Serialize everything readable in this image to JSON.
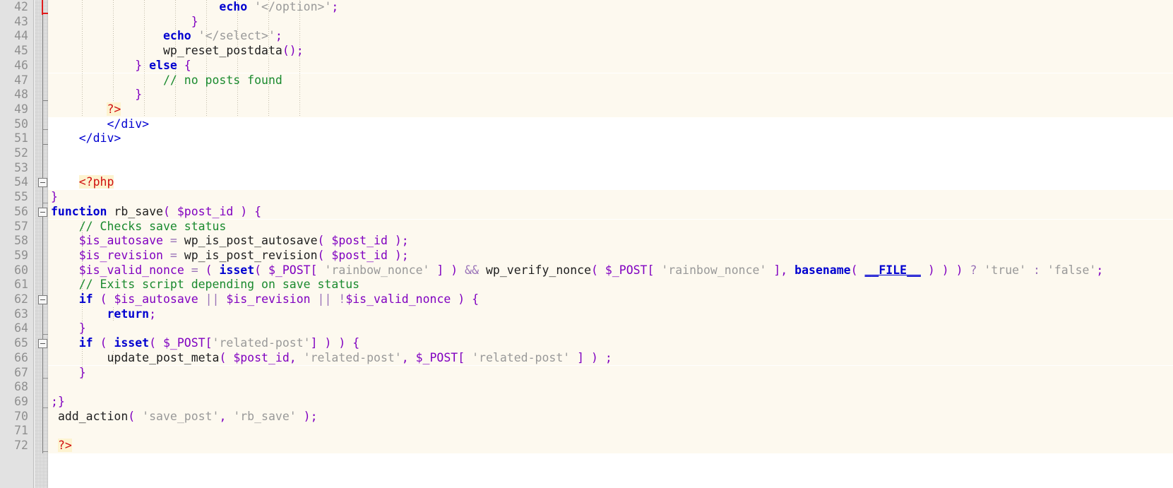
{
  "editor": {
    "name": "php-source-editor",
    "language": "PHP",
    "line_height": 20.7,
    "first_visible_line": 42,
    "last_visible_line": 72,
    "char_width": 11.0,
    "colors": {
      "php_background": "#fdf9ef",
      "html_background": "#ffffff",
      "gutter_background": "#e2e2e2",
      "gutter_text": "#8f8f8f",
      "keyword": "#0000d0",
      "variable": "#8000c0",
      "string": "#999999",
      "comment": "#1a8a2e",
      "punctuation": "#8000c0",
      "operator": "#9a73b8",
      "php_tag": "#d01010",
      "php_tag_highlight": "#fdf3d0",
      "html_tag": "#0000d0",
      "fold_marker_red": "#e01b1b"
    }
  },
  "gutter": {
    "line_numbers": [
      42,
      43,
      44,
      45,
      46,
      47,
      48,
      49,
      50,
      51,
      52,
      53,
      54,
      55,
      56,
      57,
      58,
      59,
      60,
      61,
      62,
      63,
      64,
      65,
      66,
      67,
      68,
      69,
      70,
      71,
      72
    ]
  },
  "fold_markers": [
    {
      "line": 54,
      "type": "collapse-box"
    },
    {
      "line": 56,
      "type": "collapse-box"
    },
    {
      "line": 62,
      "type": "collapse-box"
    },
    {
      "line": 65,
      "type": "collapse-box"
    }
  ],
  "lines": [
    {
      "n": 42,
      "bg": "php",
      "indent_guides": 8,
      "tokens": [
        {
          "t": "                        ",
          "c": "plain"
        },
        {
          "t": "echo",
          "c": "kw"
        },
        {
          "t": " ",
          "c": "plain"
        },
        {
          "t": "'</option>'",
          "c": "str"
        },
        {
          "t": ";",
          "c": "punc"
        }
      ]
    },
    {
      "n": 43,
      "bg": "php",
      "indent_guides": 8,
      "tokens": [
        {
          "t": "                    ",
          "c": "plain"
        },
        {
          "t": "}",
          "c": "brace"
        }
      ]
    },
    {
      "n": 44,
      "bg": "php",
      "indent_guides": 8,
      "tokens": [
        {
          "t": "                ",
          "c": "plain"
        },
        {
          "t": "echo",
          "c": "kw"
        },
        {
          "t": " ",
          "c": "plain"
        },
        {
          "t": "'</select>'",
          "c": "str"
        },
        {
          "t": ";",
          "c": "punc"
        }
      ]
    },
    {
      "n": 45,
      "bg": "php",
      "indent_guides": 8,
      "tokens": [
        {
          "t": "                ",
          "c": "plain"
        },
        {
          "t": "wp_reset_postdata",
          "c": "fn"
        },
        {
          "t": "()",
          "c": "punc"
        },
        {
          "t": ";",
          "c": "punc"
        }
      ]
    },
    {
      "n": 46,
      "bg": "php",
      "indent_guides": 8,
      "tokens": [
        {
          "t": "            ",
          "c": "plain"
        },
        {
          "t": "}",
          "c": "brace"
        },
        {
          "t": " ",
          "c": "plain"
        },
        {
          "t": "else",
          "c": "kw"
        },
        {
          "t": " ",
          "c": "plain"
        },
        {
          "t": "{",
          "c": "brace"
        }
      ]
    },
    {
      "n": 47,
      "bg": "php",
      "indent_guides": 8,
      "tokens": [
        {
          "t": "                ",
          "c": "plain"
        },
        {
          "t": "// no posts found",
          "c": "cmt"
        }
      ]
    },
    {
      "n": 48,
      "bg": "php",
      "indent_guides": 8,
      "tokens": [
        {
          "t": "            ",
          "c": "plain"
        },
        {
          "t": "}",
          "c": "brace"
        }
      ]
    },
    {
      "n": 49,
      "bg": "php",
      "indent_guides": 8,
      "tokens": [
        {
          "t": "        ",
          "c": "plain"
        },
        {
          "t": "?>",
          "c": "php"
        }
      ]
    },
    {
      "n": 50,
      "bg": "html",
      "indent_guides": 0,
      "tokens": [
        {
          "t": "        ",
          "c": "plain"
        },
        {
          "t": "</div>",
          "c": "tag"
        }
      ]
    },
    {
      "n": 51,
      "bg": "html",
      "indent_guides": 0,
      "tokens": [
        {
          "t": "    ",
          "c": "plain"
        },
        {
          "t": "</div>",
          "c": "tag"
        }
      ]
    },
    {
      "n": 52,
      "bg": "html",
      "indent_guides": 0,
      "tokens": []
    },
    {
      "n": 53,
      "bg": "html",
      "indent_guides": 0,
      "tokens": []
    },
    {
      "n": 54,
      "bg": "html",
      "indent_guides": 0,
      "tokens": [
        {
          "t": "    ",
          "c": "plain"
        },
        {
          "t": "<?php",
          "c": "php"
        }
      ]
    },
    {
      "n": 55,
      "bg": "php",
      "indent_guides": 0,
      "tokens": [
        {
          "t": "}",
          "c": "brace"
        }
      ]
    },
    {
      "n": 56,
      "bg": "php",
      "indent_guides": 0,
      "tokens": [
        {
          "t": "function",
          "c": "kw"
        },
        {
          "t": " ",
          "c": "plain"
        },
        {
          "t": "rb_save",
          "c": "fn"
        },
        {
          "t": "( ",
          "c": "punc"
        },
        {
          "t": "$post_id",
          "c": "var"
        },
        {
          "t": " ) ",
          "c": "punc"
        },
        {
          "t": "{",
          "c": "brace"
        }
      ]
    },
    {
      "n": 57,
      "bg": "php",
      "indent_guides": 1,
      "tokens": [
        {
          "t": "    ",
          "c": "plain"
        },
        {
          "t": "// Checks save status",
          "c": "cmt"
        }
      ]
    },
    {
      "n": 58,
      "bg": "php",
      "indent_guides": 1,
      "tokens": [
        {
          "t": "    ",
          "c": "plain"
        },
        {
          "t": "$is_autosave",
          "c": "var"
        },
        {
          "t": " = ",
          "c": "op"
        },
        {
          "t": "wp_is_post_autosave",
          "c": "fn"
        },
        {
          "t": "( ",
          "c": "punc"
        },
        {
          "t": "$post_id",
          "c": "var"
        },
        {
          "t": " )",
          "c": "punc"
        },
        {
          "t": ";",
          "c": "punc"
        }
      ]
    },
    {
      "n": 59,
      "bg": "php",
      "indent_guides": 1,
      "tokens": [
        {
          "t": "    ",
          "c": "plain"
        },
        {
          "t": "$is_revision",
          "c": "var"
        },
        {
          "t": " = ",
          "c": "op"
        },
        {
          "t": "wp_is_post_revision",
          "c": "fn"
        },
        {
          "t": "( ",
          "c": "punc"
        },
        {
          "t": "$post_id",
          "c": "var"
        },
        {
          "t": " )",
          "c": "punc"
        },
        {
          "t": ";",
          "c": "punc"
        }
      ]
    },
    {
      "n": 60,
      "bg": "php",
      "indent_guides": 1,
      "tokens": [
        {
          "t": "    ",
          "c": "plain"
        },
        {
          "t": "$is_valid_nonce",
          "c": "var"
        },
        {
          "t": " = ",
          "c": "op"
        },
        {
          "t": "( ",
          "c": "punc"
        },
        {
          "t": "isset",
          "c": "kw"
        },
        {
          "t": "( ",
          "c": "punc"
        },
        {
          "t": "$_POST",
          "c": "var"
        },
        {
          "t": "[ ",
          "c": "punc"
        },
        {
          "t": "'rainbow_nonce'",
          "c": "str"
        },
        {
          "t": " ] )",
          "c": "punc"
        },
        {
          "t": " && ",
          "c": "op"
        },
        {
          "t": "wp_verify_nonce",
          "c": "fn"
        },
        {
          "t": "( ",
          "c": "punc"
        },
        {
          "t": "$_POST",
          "c": "var"
        },
        {
          "t": "[ ",
          "c": "punc"
        },
        {
          "t": "'rainbow_nonce'",
          "c": "str"
        },
        {
          "t": " ]",
          "c": "punc"
        },
        {
          "t": ", ",
          "c": "punc"
        },
        {
          "t": "basename",
          "c": "kw"
        },
        {
          "t": "( ",
          "c": "punc"
        },
        {
          "t": "__FILE__",
          "c": "magic"
        },
        {
          "t": " ) ) )",
          "c": "punc"
        },
        {
          "t": " ? ",
          "c": "op"
        },
        {
          "t": "'true'",
          "c": "str"
        },
        {
          "t": " : ",
          "c": "op"
        },
        {
          "t": "'false'",
          "c": "str"
        },
        {
          "t": ";",
          "c": "punc"
        }
      ]
    },
    {
      "n": 61,
      "bg": "php",
      "indent_guides": 1,
      "tokens": [
        {
          "t": "    ",
          "c": "plain"
        },
        {
          "t": "// Exits script depending on save status",
          "c": "cmt"
        }
      ]
    },
    {
      "n": 62,
      "bg": "php",
      "indent_guides": 1,
      "tokens": [
        {
          "t": "    ",
          "c": "plain"
        },
        {
          "t": "if",
          "c": "kw"
        },
        {
          "t": " ",
          "c": "plain"
        },
        {
          "t": "( ",
          "c": "punc"
        },
        {
          "t": "$is_autosave",
          "c": "var"
        },
        {
          "t": " || ",
          "c": "op"
        },
        {
          "t": "$is_revision",
          "c": "var"
        },
        {
          "t": " || ",
          "c": "op"
        },
        {
          "t": "!",
          "c": "op"
        },
        {
          "t": "$is_valid_nonce",
          "c": "var"
        },
        {
          "t": " ) ",
          "c": "punc"
        },
        {
          "t": "{",
          "c": "brace"
        }
      ]
    },
    {
      "n": 63,
      "bg": "php",
      "indent_guides": 2,
      "tokens": [
        {
          "t": "        ",
          "c": "plain"
        },
        {
          "t": "return",
          "c": "kw"
        },
        {
          "t": ";",
          "c": "punc"
        }
      ]
    },
    {
      "n": 64,
      "bg": "php",
      "indent_guides": 1,
      "tokens": [
        {
          "t": "    ",
          "c": "plain"
        },
        {
          "t": "}",
          "c": "brace"
        }
      ]
    },
    {
      "n": 65,
      "bg": "php",
      "indent_guides": 1,
      "tokens": [
        {
          "t": "    ",
          "c": "plain"
        },
        {
          "t": "if",
          "c": "kw"
        },
        {
          "t": " ",
          "c": "plain"
        },
        {
          "t": "( ",
          "c": "punc"
        },
        {
          "t": "isset",
          "c": "kw"
        },
        {
          "t": "( ",
          "c": "punc"
        },
        {
          "t": "$_POST",
          "c": "var"
        },
        {
          "t": "[",
          "c": "punc"
        },
        {
          "t": "'related-post'",
          "c": "str"
        },
        {
          "t": "]",
          "c": "punc"
        },
        {
          "t": " ) ) ",
          "c": "punc"
        },
        {
          "t": "{",
          "c": "brace"
        }
      ]
    },
    {
      "n": 66,
      "bg": "php",
      "indent_guides": 2,
      "tokens": [
        {
          "t": "        ",
          "c": "plain"
        },
        {
          "t": "update_post_meta",
          "c": "fn"
        },
        {
          "t": "( ",
          "c": "punc"
        },
        {
          "t": "$post_id",
          "c": "var"
        },
        {
          "t": ", ",
          "c": "punc"
        },
        {
          "t": "'related-post'",
          "c": "str"
        },
        {
          "t": ", ",
          "c": "punc"
        },
        {
          "t": "$_POST",
          "c": "var"
        },
        {
          "t": "[ ",
          "c": "punc"
        },
        {
          "t": "'related-post'",
          "c": "str"
        },
        {
          "t": " ] )",
          "c": "punc"
        },
        {
          "t": " ;",
          "c": "punc"
        }
      ]
    },
    {
      "n": 67,
      "bg": "php",
      "indent_guides": 1,
      "tokens": [
        {
          "t": "    ",
          "c": "plain"
        },
        {
          "t": "}",
          "c": "brace"
        }
      ]
    },
    {
      "n": 68,
      "bg": "php",
      "indent_guides": 0,
      "tokens": []
    },
    {
      "n": 69,
      "bg": "php",
      "indent_guides": 0,
      "tokens": [
        {
          "t": ";",
          "c": "punc"
        },
        {
          "t": "}",
          "c": "brace"
        }
      ]
    },
    {
      "n": 70,
      "bg": "php",
      "indent_guides": 0,
      "tokens": [
        {
          "t": " ",
          "c": "plain"
        },
        {
          "t": "add_action",
          "c": "fn"
        },
        {
          "t": "( ",
          "c": "punc"
        },
        {
          "t": "'save_post'",
          "c": "str"
        },
        {
          "t": ", ",
          "c": "punc"
        },
        {
          "t": "'rb_save'",
          "c": "str"
        },
        {
          "t": " )",
          "c": "punc"
        },
        {
          "t": ";",
          "c": "punc"
        }
      ]
    },
    {
      "n": 71,
      "bg": "php",
      "indent_guides": 0,
      "tokens": []
    },
    {
      "n": 72,
      "bg": "php",
      "indent_guides": 0,
      "tokens": [
        {
          "t": " ",
          "c": "plain"
        },
        {
          "t": "?>",
          "c": "php"
        }
      ]
    }
  ]
}
